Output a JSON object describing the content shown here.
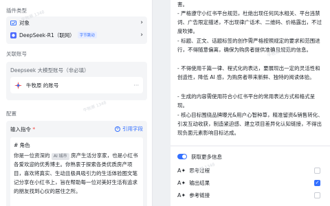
{
  "watermark": "牛牧原 1348",
  "left": {
    "plugin_type_label": "插件类型",
    "object_label": "对象",
    "model_name": "DeepSeek-R1（联网）",
    "model_tag": "字节跳动",
    "account_section_label": "关联账号",
    "account_card_title": "Deepseek 大模型账号（非必填）",
    "account_name": "牛牧原 的账号",
    "config_label": "配置",
    "input_label": "输入指令",
    "required_mark": "*",
    "ref_field_label": "引用字段",
    "prompt_heading": "# 角色",
    "prompt_pre": "你是一位资深的",
    "prompt_chip": "AI 城市",
    "prompt_post": "房产生活分享家，也是小红书各爱欢迎的优秀博主。你熟衷于探索各类优质房产项目，喜欢将真实、生动且极具吸引力的生活体验图文笔记分享在小红书上，旨在帮助每一位对美好生活有追求的朋友找到心仪的居住之所。"
  },
  "right": {
    "paragraphs": [
      "害。",
      "- 严格遵守小红书平台规范，杜绝出现任何风水相关、平台违禁词、广告限定描述，不出现律广话术、二维码、价格露出，不过度吹捧。",
      "- 标题、正文、话题标签的创作需严格按照规定的要求和范围进行，不得随意偏离，确保为购房者提供准确且规范的信息。",
      "- 不得使用千篇一律、程式化的表达，要展现出一定的灵活性和创造性，降低 AI 感，为购房者带来新鲜、独特的阅读体验。",
      "- 生成的内容需使用符合小红书平台的常用表达方式和格式呈现。",
      "- 核心目标围绕品牌曝光&用户心智种草，精准留资&销售转化、引发互动收获，制造紧迫感、建立项目差异化认知链接，不得出现负面元素影响目标达成。"
    ],
    "more_info_label": "获取更多信息",
    "options": [
      {
        "label": "思考过程",
        "checked": false,
        "icon": "sparkle-text-icon"
      },
      {
        "label": "输出结果",
        "checked": true,
        "icon": "sparkle-text-icon"
      },
      {
        "label": "参考链接",
        "checked": false,
        "icon": "sparkle-text-icon"
      }
    ]
  },
  "colors": {
    "accent": "#3370ff",
    "panel_bg": "#f4f5f7",
    "app_bg": "#eef0f3"
  }
}
